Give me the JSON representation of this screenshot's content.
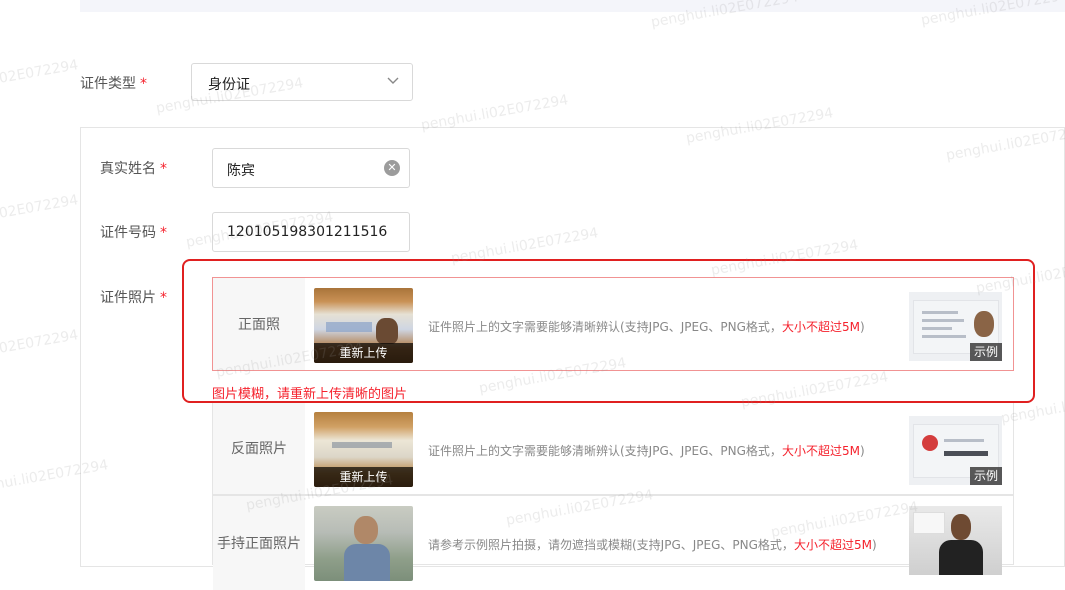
{
  "form": {
    "cert_type": {
      "label": "证件类型",
      "required_mark": "*",
      "value": "身份证"
    },
    "real_name": {
      "label": "真实姓名",
      "required_mark": "*",
      "value": "陈宾"
    },
    "cert_number": {
      "label": "证件号码",
      "required_mark": "*",
      "value": "120105198301211516"
    },
    "cert_photo": {
      "label": "证件照片",
      "required_mark": "*"
    }
  },
  "uploads": [
    {
      "title": "正面照",
      "reupload": "重新上传",
      "hint": "证件照片上的文字需要能够清晰辨认(支持JPG、JPEG、PNG格式，",
      "hint_red": "大小不超过5M",
      "hint_end": ")",
      "example": "示例",
      "error": "图片模糊，请重新上传清晰的图片"
    },
    {
      "title": "反面照片",
      "reupload": "重新上传",
      "hint": "证件照片上的文字需要能够清晰辨认(支持JPG、JPEG、PNG格式，",
      "hint_red": "大小不超过5M",
      "hint_end": ")",
      "example": "示例"
    },
    {
      "title": "手持正面照片",
      "hint": "请参考示例照片拍摄，请勿遮挡或模糊(支持JPG、JPEG、PNG格式，",
      "hint_red": "大小不超过5M",
      "hint_end": ")"
    }
  ],
  "watermark": "penghui.li02E072294",
  "colors": {
    "required": "#f5222d",
    "error": "#f5222d",
    "highlight": "#e02020"
  }
}
